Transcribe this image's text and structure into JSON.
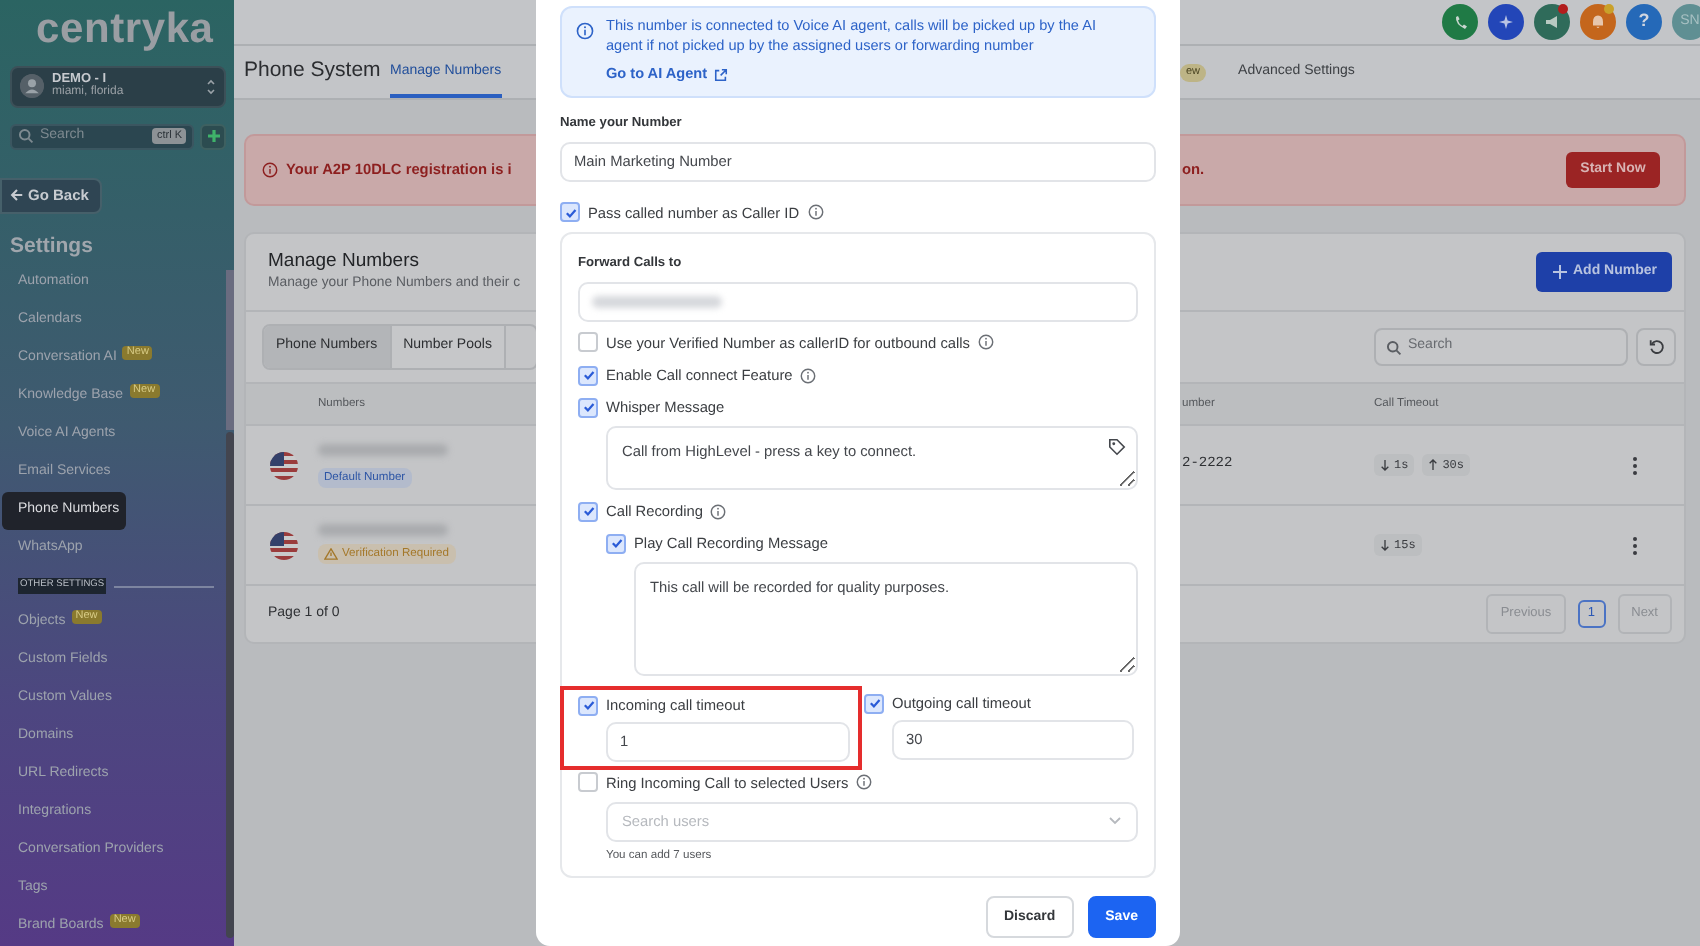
{
  "sidebar": {
    "logo": "centryka",
    "account": {
      "name": "DEMO - I",
      "location": "miami, florida"
    },
    "search": {
      "placeholder": "Search",
      "shortcut": "ctrl K"
    },
    "back_button": "Go Back",
    "heading": "Settings",
    "items": [
      {
        "kind": "item",
        "label": "Automation",
        "selected": false
      },
      {
        "kind": "item",
        "label": "Calendars",
        "selected": false
      },
      {
        "kind": "item",
        "label": "Conversation AI",
        "badge": "New",
        "selected": false
      },
      {
        "kind": "item",
        "label": "Knowledge Base",
        "badge": "New",
        "selected": false
      },
      {
        "kind": "item",
        "label": "Voice AI Agents",
        "selected": false
      },
      {
        "kind": "item",
        "label": "Email Services",
        "selected": false
      },
      {
        "kind": "item",
        "label": "Phone Numbers",
        "selected": true
      },
      {
        "kind": "item",
        "label": "WhatsApp",
        "selected": false
      },
      {
        "kind": "section",
        "label": "OTHER SETTINGS"
      },
      {
        "kind": "item",
        "label": "Objects",
        "badge": "New",
        "selected": false
      },
      {
        "kind": "item",
        "label": "Custom Fields",
        "selected": false
      },
      {
        "kind": "item",
        "label": "Custom Values",
        "selected": false
      },
      {
        "kind": "item",
        "label": "Domains",
        "selected": false
      },
      {
        "kind": "item",
        "label": "URL Redirects",
        "selected": false
      },
      {
        "kind": "item",
        "label": "Integrations",
        "selected": false
      },
      {
        "kind": "item",
        "label": "Conversation Providers",
        "selected": false
      },
      {
        "kind": "item",
        "label": "Tags",
        "selected": false
      },
      {
        "kind": "item",
        "label": "Brand Boards",
        "badge": "New",
        "selected": false
      }
    ]
  },
  "topbar": {
    "icons": [
      {
        "kind": "phone",
        "color": "#1f7a45"
      },
      {
        "kind": "sparkle",
        "color": "#2346b8"
      },
      {
        "kind": "megaphone",
        "color": "#2f6b5a",
        "dot": true
      },
      {
        "kind": "bell",
        "color": "#c4661c",
        "dot": true
      },
      {
        "kind": "help",
        "color": "#2569b8",
        "label": "?"
      }
    ],
    "avatar": "SN"
  },
  "page_header": {
    "title": "Phone System",
    "tabs": [
      {
        "label": "Manage Numbers",
        "selected": true
      },
      {
        "label": "Advanced Settings",
        "selected": false
      }
    ],
    "partial_badge": "ew"
  },
  "banner": {
    "text_start": "Your A2P 10DLC registration is i",
    "text_end": "on.",
    "button": "Start Now"
  },
  "numbers_card": {
    "title": "Manage Numbers",
    "subtitle": "Manage your Phone Numbers and their c",
    "add_button": "Add Number",
    "segments": [
      {
        "label": "Phone Numbers",
        "selected": true
      },
      {
        "label": "Number Pools",
        "selected": false
      }
    ],
    "search": {
      "placeholder": "Search"
    },
    "table": {
      "columns": [
        "Numbers",
        "umber",
        "Call Timeout"
      ],
      "rows": [
        {
          "number_blurred": true,
          "tag": {
            "kind": "default",
            "label": "Default Number"
          },
          "column_2": "2-2222",
          "timeouts": [
            {
              "kind": "in",
              "value": "1s"
            },
            {
              "kind": "out",
              "value": "30s"
            }
          ]
        },
        {
          "number_blurred": true,
          "tag": {
            "kind": "warning",
            "label": "Verification Required"
          },
          "timeouts": [
            {
              "kind": "in",
              "value": "15s"
            }
          ]
        }
      ]
    },
    "footer": "Page 1 of 0",
    "pagination": {
      "previous": "Previous",
      "pages": [
        {
          "label": "1",
          "selected": true
        }
      ],
      "next": "Next"
    }
  },
  "modal": {
    "info": {
      "text": "This number is connected to Voice AI agent, calls will be picked up by the AI agent if not picked up by the assigned users or forwarding number",
      "link": "Go to AI Agent"
    },
    "name_field": {
      "label": "Name your Number",
      "value": "Main Marketing Number"
    },
    "pass_caller_id": {
      "label": "Pass called number as Caller ID",
      "checked": true
    },
    "forward": {
      "label": "Forward Calls to",
      "value_blurred": true
    },
    "options": [
      {
        "kind": "checkbox",
        "label": "Use your Verified Number as callerID for outbound calls",
        "checked": false,
        "info": true
      },
      {
        "kind": "checkbox",
        "label": "Enable Call connect Feature",
        "checked": true,
        "info": true
      },
      {
        "kind": "message",
        "label": "Whisper Message",
        "checked": true,
        "value": "Call from HighLevel - press a key to connect."
      },
      {
        "kind": "checkbox",
        "label": "Call Recording",
        "checked": true,
        "info": true,
        "children": [
          {
            "kind": "message",
            "label": "Play Call Recording Message",
            "checked": true,
            "value": "This call will be recorded for quality purposes."
          }
        ]
      }
    ],
    "timeouts": [
      {
        "label": "Incoming call timeout",
        "checked": true,
        "value": "1",
        "highlighted": true
      },
      {
        "label": "Outgoing call timeout",
        "checked": true,
        "value": "30"
      }
    ],
    "ring": {
      "label": "Ring Incoming Call to selected Users",
      "checked": false,
      "placeholder": "Search users",
      "hint": "You can add 7 users"
    },
    "buttons": [
      {
        "kind": "secondary",
        "label": "Discard"
      },
      {
        "kind": "primary",
        "label": "Save"
      }
    ]
  }
}
